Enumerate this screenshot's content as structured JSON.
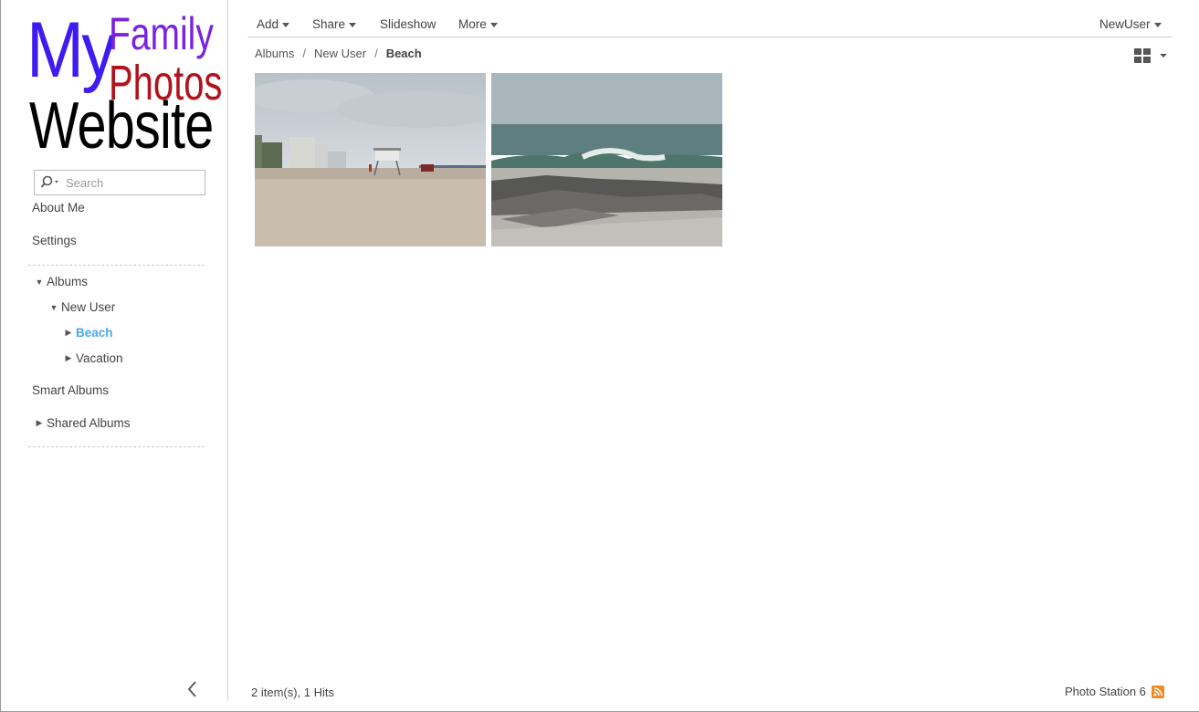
{
  "logo": {
    "my": "My",
    "family": "Family",
    "photos": "Photos",
    "website": "Website"
  },
  "search": {
    "placeholder": "Search"
  },
  "sidebar": {
    "about": "About Me",
    "settings": "Settings",
    "albums": "Albums",
    "new_user": "New User",
    "beach": "Beach",
    "vacation": "Vacation",
    "smart_albums": "Smart Albums",
    "shared_albums": "Shared Albums"
  },
  "toolbar": {
    "add": "Add",
    "share": "Share",
    "slideshow": "Slideshow",
    "more": "More",
    "user": "NewUser"
  },
  "breadcrumb": {
    "albums": "Albums",
    "sep": "/",
    "new_user": "New User",
    "current": "Beach"
  },
  "status": {
    "count": "2 item(s), 1 Hits"
  },
  "footer": {
    "brand": "Photo Station 6"
  },
  "colors": {
    "active_item": "#4aa8e8",
    "logo_my": "#3e1cf1",
    "logo_family": "#7a22e0",
    "logo_photos": "#b1121c",
    "rss": "#f08a24"
  }
}
